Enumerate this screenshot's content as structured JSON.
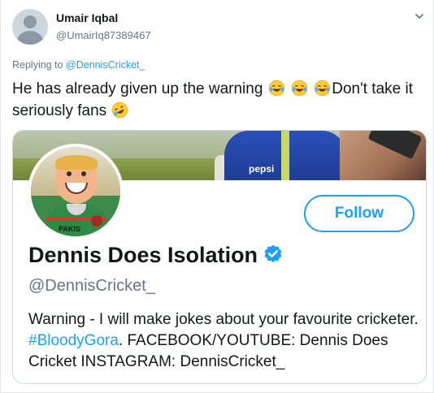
{
  "tweet": {
    "author_name": "Umair Iqbal",
    "author_handle": "@UmairIq87389467",
    "replying_prefix": "Replying to",
    "replying_handle": "@DennisCricket_",
    "text_part1": "He has already given up the warning",
    "text_part2": "Don't take it seriously fans",
    "emoji_1": "😂",
    "emoji_2": "🤣"
  },
  "card": {
    "banner_sponsor_text": "pepsi",
    "jersey_text": "PAKIS",
    "follow_label": "Follow",
    "display_name": "Dennis Does Isolation",
    "handle": "@DennisCricket_",
    "bio_part1": "Warning - I will make jokes about your favourite cricketer.",
    "bio_hashtag": "#BloodyGora",
    "bio_part2": ". FACEBOOK/YOUTUBE: Dennis Does Cricket INSTAGRAM: DennisCricket_"
  },
  "colors": {
    "accent_blue": "#1da1f2",
    "text_primary": "#14171a",
    "text_secondary": "#657786"
  },
  "icons": {
    "caret": "chevron-down-icon",
    "verified": "verified-badge-icon",
    "avatar": "default-avatar-icon"
  }
}
